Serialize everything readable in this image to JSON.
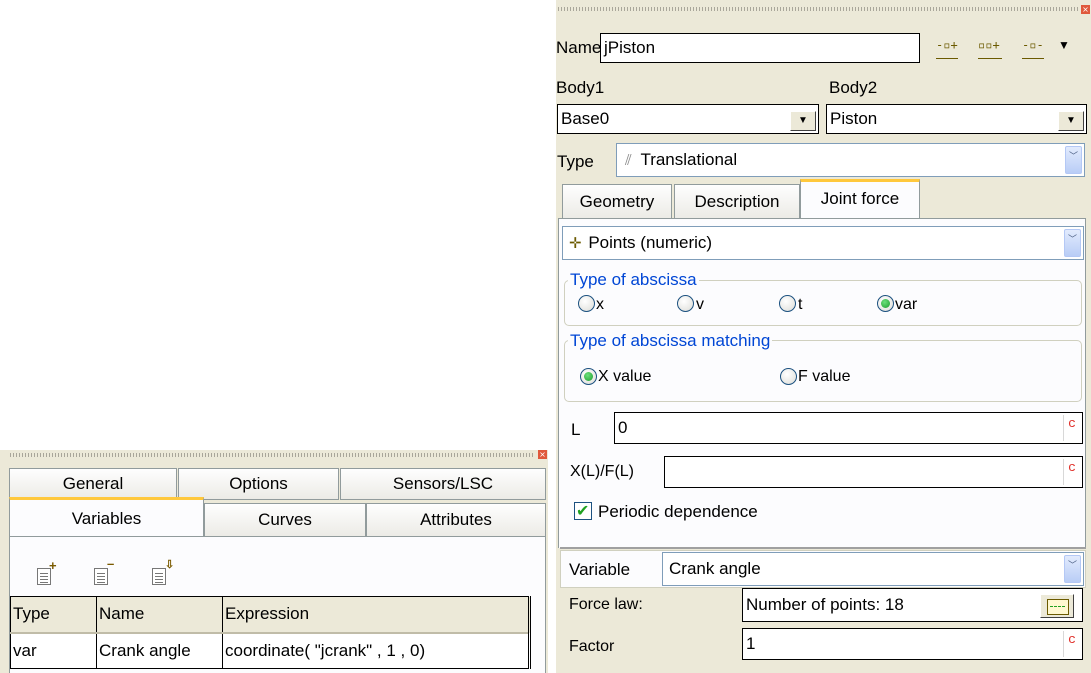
{
  "joint": {
    "name_label": "Name",
    "name_value": "jPiston",
    "body1_label": "Body1",
    "body1_value": "Base0",
    "body2_label": "Body2",
    "body2_value": "Piston",
    "type_label": "Type",
    "type_value": "Translational",
    "tabs": [
      "Geometry",
      "Description",
      "Joint force"
    ],
    "active_tab": "Joint force",
    "force_mode": "Points (numeric)",
    "abscissa_group": {
      "title": "Type of abscissa",
      "options": [
        "x",
        "v",
        "t",
        "var"
      ],
      "selected": "var"
    },
    "matching_group": {
      "title": "Type of abscissa matching",
      "options": [
        "X value",
        "F value"
      ],
      "selected": "X value"
    },
    "L_label": "L",
    "L_value": "0",
    "XL_label": "X(L)/F(L)",
    "XL_value": "",
    "c_button": "c",
    "periodic_label": "Periodic dependence",
    "periodic_checked": true,
    "variable_label": "Variable",
    "variable_value": "Crank angle",
    "force_law_label": "Force law:",
    "force_law_value": "Number of points: 18",
    "factor_label": "Factor",
    "factor_value": "1"
  },
  "left": {
    "tabs_row1": [
      "General",
      "Options",
      "Sensors/LSC"
    ],
    "tabs_row2": [
      "Variables",
      "Curves",
      "Attributes"
    ],
    "active_tab": "Variables",
    "table": {
      "headers": [
        "Type",
        "Name",
        "Expression"
      ],
      "rows": [
        [
          "var",
          "Crank angle",
          "coordinate( \"jcrank\" , 1 , 0)"
        ]
      ]
    }
  },
  "colors": {
    "panel_bg": "#ece9d8",
    "legend_blue": "#0046d5",
    "active_tab_accent": "#ffc83c",
    "radio_green": "#1f9c2f",
    "close_red": "#e0593c"
  }
}
